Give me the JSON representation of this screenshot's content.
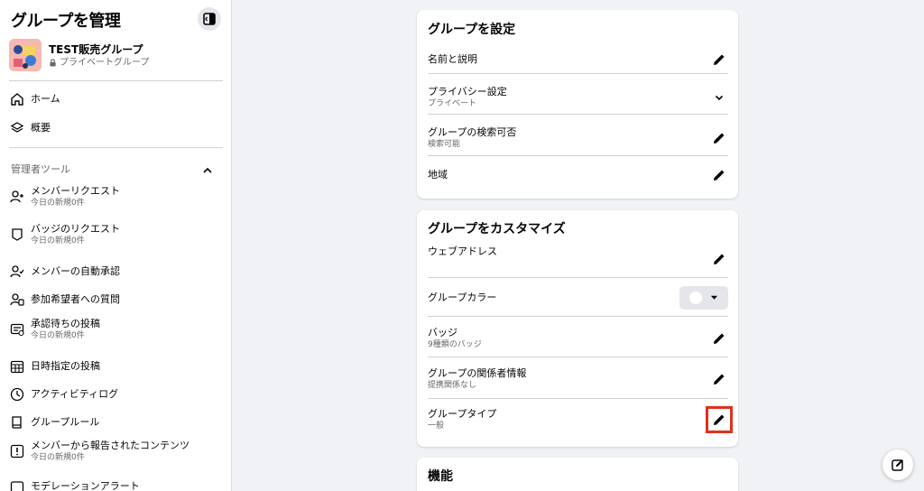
{
  "sidebar": {
    "title": "グループを管理",
    "group": {
      "name": "TEST販売グループ",
      "privacy": "プライベートグループ"
    },
    "nav": [
      {
        "label": "ホーム",
        "icon": "home-icon"
      },
      {
        "label": "概要",
        "icon": "layers-icon"
      }
    ],
    "admin_section": "管理者ツール",
    "admin_items": [
      {
        "label": "メンバーリクエスト",
        "sub": "今日の新規0件",
        "icon": "person-add-icon"
      },
      {
        "label": "バッジのリクエスト",
        "sub": "今日の新規0件",
        "icon": "badge-icon"
      },
      {
        "label": "メンバーの自動承認",
        "sub": "",
        "icon": "person-check-icon"
      },
      {
        "label": "参加希望者への質問",
        "sub": "",
        "icon": "person-question-icon"
      },
      {
        "label": "承認待ちの投稿",
        "sub": "今日の新規0件",
        "icon": "post-pending-icon"
      },
      {
        "label": "日時指定の投稿",
        "sub": "",
        "icon": "calendar-icon"
      },
      {
        "label": "アクティビティログ",
        "sub": "",
        "icon": "clock-icon"
      },
      {
        "label": "グループルール",
        "sub": "",
        "icon": "book-icon"
      },
      {
        "label": "メンバーから報告されたコンテンツ",
        "sub": "今日の新規0件",
        "icon": "report-icon"
      },
      {
        "label": "モデレーションアラート",
        "sub": "",
        "icon": "alert-icon"
      }
    ]
  },
  "settings_card": {
    "title": "グループを設定",
    "rows": [
      {
        "label": "名前と説明",
        "sub": ""
      },
      {
        "label": "プライバシー設定",
        "sub": "プライベート"
      },
      {
        "label": "グループの検索可否",
        "sub": "検索可能"
      },
      {
        "label": "地域",
        "sub": ""
      }
    ]
  },
  "customize_card": {
    "title": "グループをカスタマイズ",
    "rows": [
      {
        "label": "ウェブアドレス",
        "sub": ""
      },
      {
        "label": "グループカラー",
        "sub": ""
      },
      {
        "label": "バッジ",
        "sub": "9種類のバッジ"
      },
      {
        "label": "グループの関係者情報",
        "sub": "提携関係なし"
      },
      {
        "label": "グループタイプ",
        "sub": "一般"
      }
    ]
  },
  "features_card": {
    "title": "機能"
  },
  "colors": {
    "accent": "#1877f2",
    "highlight": "#e0301e"
  }
}
